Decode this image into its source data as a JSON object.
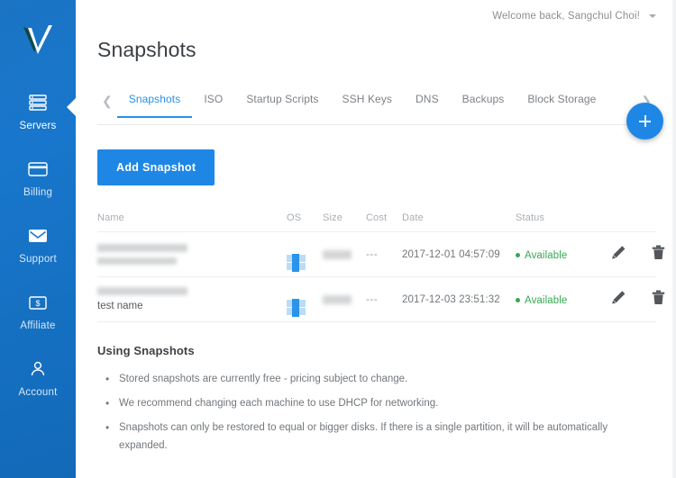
{
  "sidebar": {
    "logo_name": "vultr-logo",
    "items": [
      {
        "label": "Servers",
        "icon": "server-stack-icon",
        "active": true
      },
      {
        "label": "Billing",
        "icon": "credit-card-icon",
        "active": false
      },
      {
        "label": "Support",
        "icon": "envelope-icon",
        "active": false
      },
      {
        "label": "Affiliate",
        "icon": "dollar-bill-icon",
        "active": false
      },
      {
        "label": "Account",
        "icon": "person-icon",
        "active": false
      }
    ],
    "background_color": "#1877cc"
  },
  "topbar": {
    "welcome_text": "Welcome back, Sangchul Choi!",
    "caret_icon": "chevron-down-icon"
  },
  "header": {
    "page_title": "Snapshots"
  },
  "tabs": {
    "prev_icon": "chevron-left-icon",
    "next_icon": "chevron-right-icon",
    "items": [
      {
        "label": "Snapshots",
        "active": true
      },
      {
        "label": "ISO",
        "active": false
      },
      {
        "label": "Startup Scripts",
        "active": false
      },
      {
        "label": "SSH Keys",
        "active": false
      },
      {
        "label": "DNS",
        "active": false
      },
      {
        "label": "Backups",
        "active": false
      },
      {
        "label": "Block Storage",
        "active": false
      }
    ],
    "accent_color": "#2690ea"
  },
  "fab": {
    "icon": "plus-icon",
    "color": "#1e87e5"
  },
  "actions": {
    "add_snapshot_label": "Add Snapshot",
    "add_snapshot_color": "#1e87e5"
  },
  "table": {
    "columns": [
      "Name",
      "OS",
      "Size",
      "Cost",
      "Date",
      "Status"
    ],
    "rows": [
      {
        "name_primary": "",
        "name_secondary": "",
        "name_redacted": true,
        "os_icon": "windows-icon",
        "size": "",
        "size_redacted": true,
        "cost": "---",
        "date": "2017-12-01 04:57:09",
        "status": "Available",
        "status_color": "#35a853",
        "edit_icon": "pencil-icon",
        "delete_icon": "trash-icon"
      },
      {
        "name_primary": "",
        "name_secondary": "test name",
        "name_redacted": true,
        "os_icon": "windows-icon",
        "size": "",
        "size_redacted": true,
        "cost": "---",
        "date": "2017-12-03 23:51:32",
        "status": "Available",
        "status_color": "#35a853",
        "edit_icon": "pencil-icon",
        "delete_icon": "trash-icon"
      }
    ]
  },
  "help": {
    "heading": "Using Snapshots",
    "bullets": [
      "Stored snapshots are currently free - pricing subject to change.",
      "We recommend changing each machine to use DHCP for networking.",
      "Snapshots can only be restored to equal or bigger disks. If there is a single partition, it will be automatically expanded."
    ]
  }
}
